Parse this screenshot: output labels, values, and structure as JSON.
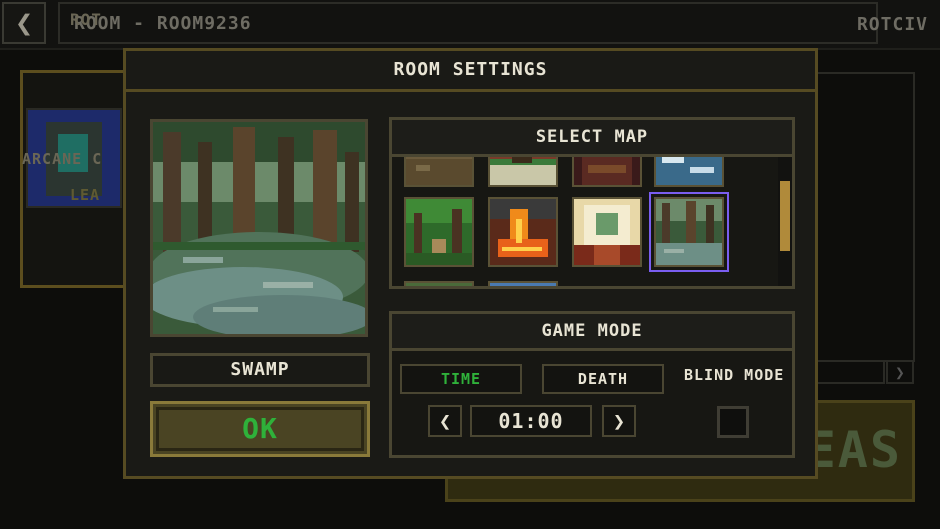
{
  "topbar": {
    "back_icon": "chevron-left-icon",
    "back_glyph": "❮",
    "room_title": "ROOM - ROOM9236",
    "user_name": "ROTCIV"
  },
  "background": {
    "card_name": "ROT",
    "card_class": "ARCANE C",
    "card_sub": "LEA",
    "start_text": "EAS",
    "arrow_glyph": "❯"
  },
  "modal": {
    "title": "ROOM SETTINGS",
    "selected_map_name": "SWAMP",
    "ok_label": "OK",
    "select_map": {
      "header": "SELECT MAP",
      "maps": [
        {
          "name": "dirt",
          "selected": false
        },
        {
          "name": "mansion",
          "selected": false
        },
        {
          "name": "library",
          "selected": false
        },
        {
          "name": "ice",
          "selected": false
        },
        {
          "name": "forest",
          "selected": false
        },
        {
          "name": "lava",
          "selected": false
        },
        {
          "name": "hallway",
          "selected": false
        },
        {
          "name": "swamp",
          "selected": true
        }
      ]
    },
    "game_mode": {
      "header": "GAME MODE",
      "time_label": "TIME",
      "death_label": "DEATH",
      "blind_label": "BLIND MODE",
      "timer_value": "01:00",
      "prev_glyph": "❮",
      "next_glyph": "❯",
      "active_mode": "TIME",
      "blind_enabled": false
    }
  },
  "colors": {
    "active_mode": "#2fb13a",
    "inactive_mode": "#e8e4d4",
    "gold_border": "#564b22",
    "selection": "#7a5ef0"
  }
}
